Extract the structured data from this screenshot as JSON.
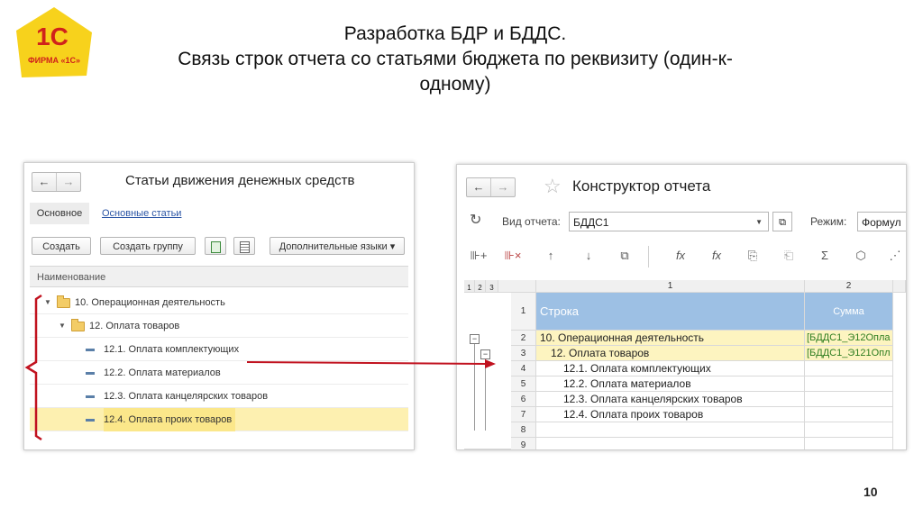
{
  "logo": {
    "brand": "1С",
    "caption": "ФИРМА «1С»"
  },
  "slide": {
    "title_line1": "Разработка БДР и БДДС.",
    "title_line2": "Связь строк отчета со статьями бюджета по реквизиту (один-к-",
    "title_line3": "одному)",
    "page_number": "10"
  },
  "left_window": {
    "back_icon": "←",
    "forward_icon": "→",
    "title": "Статьи движения денежных средств",
    "tab_main": "Основное",
    "tab_link": "Основные статьи",
    "btn_create": "Создать",
    "btn_create_group": "Создать группу",
    "btn_languages": "Дополнительные языки ▾",
    "column_header": "Наименование",
    "rows": [
      {
        "label": "10. Операционная деятельность",
        "type": "folder"
      },
      {
        "label": "12. Оплата товаров",
        "type": "folder"
      },
      {
        "label": "12.1. Оплата комплектующих",
        "type": "item"
      },
      {
        "label": "12.2. Оплата материалов",
        "type": "item"
      },
      {
        "label": "12.3. Оплата канцелярских товаров",
        "type": "item"
      },
      {
        "label": "12.4. Оплата проих товаров",
        "type": "item",
        "selected": true
      }
    ]
  },
  "right_window": {
    "back_icon": "←",
    "forward_icon": "→",
    "star_icon": "☆",
    "title": "Конструктор отчета",
    "refresh_icon": "↻",
    "report_type_label": "Вид отчета:",
    "report_type_value": "БДДС1",
    "mode_label": "Режим:",
    "mode_value": "Формул",
    "toolbar_icons": [
      "⊪+",
      "⊪×",
      "↑",
      "↓",
      "⧉",
      "fx",
      "fx",
      "⎘",
      "⎗",
      "Σ",
      "⬡",
      "⋰"
    ],
    "level_buttons": [
      "1",
      "2",
      "3"
    ],
    "col1_header": "1",
    "col2_header": "2",
    "header_row_num": "1",
    "header_col1": "Строка",
    "header_col2": "Сумма",
    "rows": [
      {
        "num": "2",
        "text": "10. Операционная деятельность",
        "formula": "[БДДС1_Э12Опла",
        "style": "yellow"
      },
      {
        "num": "3",
        "text": "12. Оплата товаров",
        "formula": "[БДДС1_Э121Опл",
        "style": "yellow"
      },
      {
        "num": "4",
        "text": "12.1. Оплата комплектующих",
        "formula": "",
        "style": ""
      },
      {
        "num": "5",
        "text": "12.2. Оплата материалов",
        "formula": "",
        "style": ""
      },
      {
        "num": "6",
        "text": "12.3. Оплата канцелярских товаров",
        "formula": "",
        "style": ""
      },
      {
        "num": "7",
        "text": "12.4. Оплата проих товаров",
        "formula": "",
        "style": ""
      },
      {
        "num": "8",
        "text": "",
        "formula": "",
        "style": ""
      },
      {
        "num": "9",
        "text": "",
        "formula": "",
        "style": ""
      }
    ]
  },
  "colors": {
    "accent_red": "#c1121f",
    "selection_yellow": "#fdf0b0",
    "header_blue": "#9dc0e4",
    "link_blue": "#2b55a5"
  }
}
